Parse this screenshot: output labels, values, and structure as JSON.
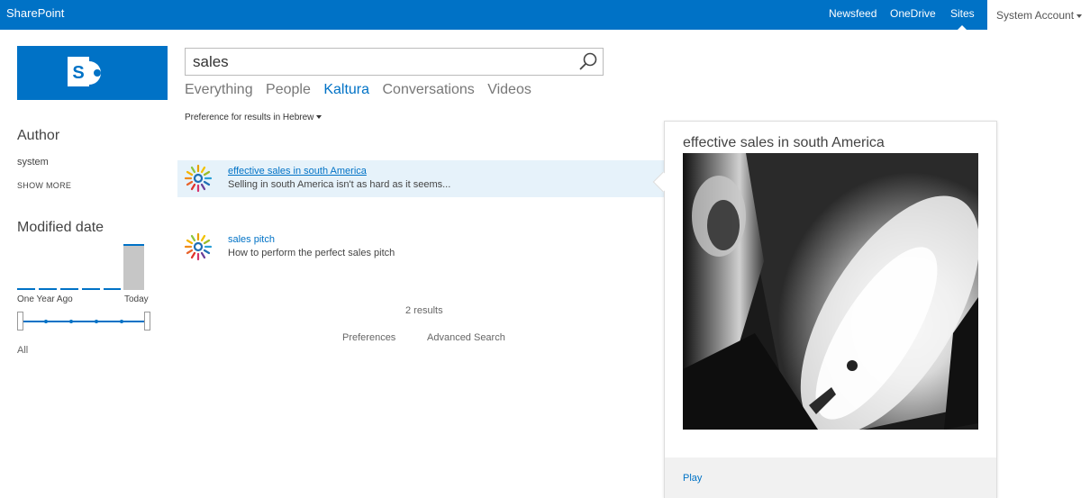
{
  "suitebar": {
    "brand": "SharePoint",
    "nav": [
      "Newsfeed",
      "OneDrive",
      "Sites"
    ],
    "active_nav": "Sites",
    "account": "System Account"
  },
  "search": {
    "query": "sales",
    "verticals": [
      "Everything",
      "People",
      "Kaltura",
      "Conversations",
      "Videos"
    ],
    "selected_vertical": "Kaltura",
    "language_pref": "Preference for results in Hebrew"
  },
  "refiners": {
    "author": {
      "title": "Author",
      "values": [
        "system"
      ],
      "show_more": "SHOW MORE"
    },
    "modified": {
      "title": "Modified date",
      "range_start": "One Year Ago",
      "range_end": "Today",
      "selected": "All"
    }
  },
  "results": [
    {
      "title": "effective sales in south America",
      "description": "Selling in south America isn't as hard as it seems..."
    },
    {
      "title": "sales pitch",
      "description": "How to perform the perfect sales pitch"
    }
  ],
  "result_count": "2 results",
  "footer_links": [
    "Preferences",
    "Advanced Search"
  ],
  "hover_panel": {
    "title": "effective sales in south America",
    "action": "Play"
  },
  "colors": {
    "accent": "#0072c6",
    "highlight": "#e6f2fa"
  }
}
